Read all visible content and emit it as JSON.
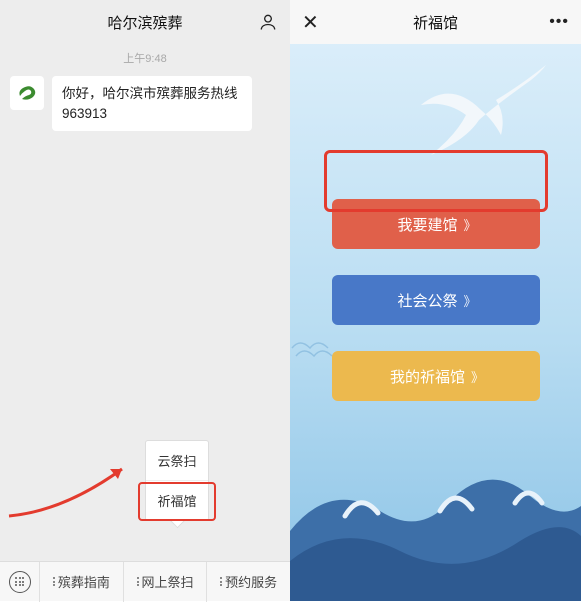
{
  "left": {
    "title": "哈尔滨殡葬",
    "timestamp": "上午9:48",
    "message": "你好，哈尔滨市殡葬服务热线963913",
    "popup": {
      "item1": "云祭扫",
      "item2": "祈福馆"
    },
    "menu": {
      "m1": "殡葬指南",
      "m2": "网上祭扫",
      "m3": "预约服务"
    }
  },
  "right": {
    "title": "祈福馆",
    "closeGlyph": "✕",
    "moreGlyph": "•••",
    "btn1": "我要建馆",
    "btn2": "社会公祭",
    "btn3": "我的祈福馆",
    "chev": "》"
  }
}
